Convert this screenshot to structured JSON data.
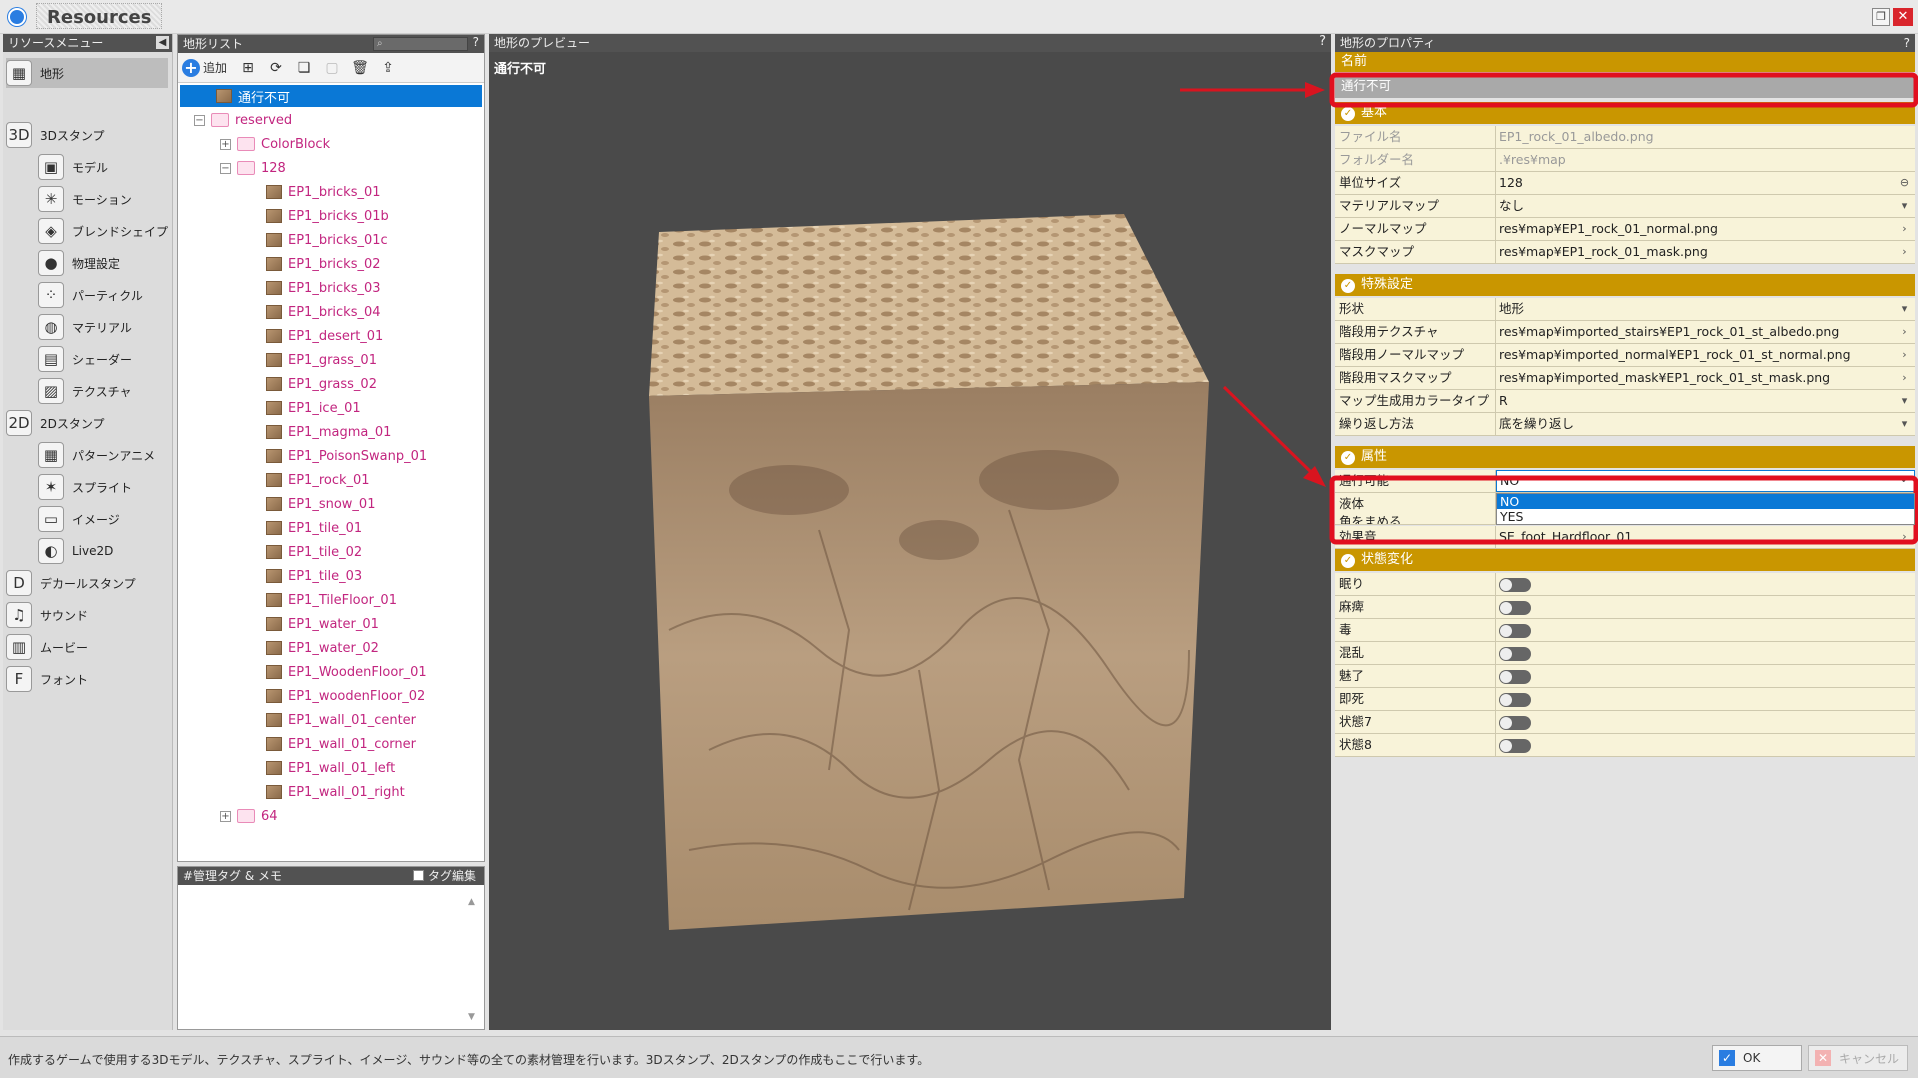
{
  "window": {
    "title": "Resources",
    "restore_glyph": "❐",
    "close_glyph": "✕"
  },
  "menu": {
    "header": "リソースメニュー",
    "collapse_glyph": "◀",
    "items": [
      {
        "label": "地形",
        "icon": "terrain-icon",
        "glyph": "▦"
      },
      {
        "label": "3Dスタンプ",
        "icon": "3d-stamp-icon",
        "glyph": "3D"
      },
      {
        "label": "モデル",
        "icon": "model-icon",
        "glyph": "▣"
      },
      {
        "label": "モーション",
        "icon": "motion-icon",
        "glyph": "✳"
      },
      {
        "label": "ブレンドシェイプ",
        "icon": "blendshape-icon",
        "glyph": "◈"
      },
      {
        "label": "物理設定",
        "icon": "physics-icon",
        "glyph": "●"
      },
      {
        "label": "パーティクル",
        "icon": "particle-icon",
        "glyph": "⁘"
      },
      {
        "label": "マテリアル",
        "icon": "material-icon",
        "glyph": "◍"
      },
      {
        "label": "シェーダー",
        "icon": "shader-icon",
        "glyph": "▤"
      },
      {
        "label": "テクスチャ",
        "icon": "texture-icon",
        "glyph": "▨"
      },
      {
        "label": "2Dスタンプ",
        "icon": "2d-stamp-icon",
        "glyph": "2D"
      },
      {
        "label": "パターンアニメ",
        "icon": "pattern-anime-icon",
        "glyph": "▦"
      },
      {
        "label": "スプライト",
        "icon": "sprite-icon",
        "glyph": "✶"
      },
      {
        "label": "イメージ",
        "icon": "image-icon",
        "glyph": "▭"
      },
      {
        "label": "Live2D",
        "icon": "live2d-icon",
        "glyph": "◐"
      },
      {
        "label": "デカールスタンプ",
        "icon": "decal-stamp-icon",
        "glyph": "D"
      },
      {
        "label": "サウンド",
        "icon": "sound-icon",
        "glyph": "♫"
      },
      {
        "label": "ムービー",
        "icon": "movie-icon",
        "glyph": "▥"
      },
      {
        "label": "フォント",
        "icon": "font-icon",
        "glyph": "F"
      }
    ]
  },
  "list": {
    "header": "地形リスト",
    "help": "?",
    "search_icon": "⌕",
    "add_label": "追加",
    "tree": {
      "selected": "通行不可",
      "reserved": "reserved",
      "colorblock": "ColorBlock",
      "folder128": "128",
      "items": [
        "EP1_bricks_01",
        "EP1_bricks_01b",
        "EP1_bricks_01c",
        "EP1_bricks_02",
        "EP1_bricks_03",
        "EP1_bricks_04",
        "EP1_desert_01",
        "EP1_grass_01",
        "EP1_grass_02",
        "EP1_ice_01",
        "EP1_magma_01",
        "EP1_PoisonSwanp_01",
        "EP1_rock_01",
        "EP1_snow_01",
        "EP1_tile_01",
        "EP1_tile_02",
        "EP1_tile_03",
        "EP1_TileFloor_01",
        "EP1_water_01",
        "EP1_water_02",
        "EP1_WoodenFloor_01",
        "EP1_woodenFloor_02",
        "EP1_wall_01_center",
        "EP1_wall_01_corner",
        "EP1_wall_01_left",
        "EP1_wall_01_right"
      ],
      "folder64": "64"
    }
  },
  "tag": {
    "header": "#管理タグ & メモ",
    "edit_label": "タグ編集"
  },
  "preview": {
    "header": "地形のプレビュー",
    "help": "?",
    "name": "通行不可"
  },
  "props": {
    "header": "地形のプロパティ",
    "help": "?",
    "name_section": "名前",
    "name_value": "通行不可",
    "basic_section": "基本",
    "basic": [
      {
        "k": "ファイル名",
        "v": "EP1_rock_01_albedo.png"
      },
      {
        "k": "フォルダー名",
        "v": ".¥res¥map"
      },
      {
        "k": "単位サイズ",
        "v": "128"
      },
      {
        "k": "マテリアルマップ",
        "v": "なし"
      },
      {
        "k": "ノーマルマップ",
        "v": "res¥map¥EP1_rock_01_normal.png"
      },
      {
        "k": "マスクマップ",
        "v": "res¥map¥EP1_rock_01_mask.png"
      }
    ],
    "special_section": "特殊設定",
    "special": [
      {
        "k": "形状",
        "v": "地形"
      },
      {
        "k": "階段用テクスチャ",
        "v": "res¥map¥imported_stairs¥EP1_rock_01_st_albedo.png"
      },
      {
        "k": "階段用ノーマルマップ",
        "v": "res¥map¥imported_normal¥EP1_rock_01_st_normal.png"
      },
      {
        "k": "階段用マスクマップ",
        "v": "res¥map¥imported_mask¥EP1_rock_01_st_mask.png"
      },
      {
        "k": "マップ生成用カラータイプ",
        "v": "R"
      },
      {
        "k": "繰り返し方法",
        "v": "底を繰り返し"
      }
    ],
    "attr_section": "属性",
    "passable": {
      "k": "通行可能",
      "v": "NO",
      "options": [
        "NO",
        "YES"
      ]
    },
    "liquid": {
      "k": "液体"
    },
    "round": {
      "k": "角をまめる"
    },
    "sound": {
      "k": "効果音",
      "v": "SE_foot_Hardfloor_01"
    },
    "status_section": "状態変化",
    "status": [
      "眠り",
      "麻痺",
      "毒",
      "混乱",
      "魅了",
      "即死",
      "状態7",
      "状態8"
    ]
  },
  "statusbar": {
    "text": "作成するゲームで使用する3Dモデル、テクスチャ、スプライト、イメージ、サウンド等の全ての素材管理を行います。3Dスタンプ、2Dスタンプの作成もここで行います。",
    "ok": "OK",
    "cancel": "キャンセル"
  }
}
